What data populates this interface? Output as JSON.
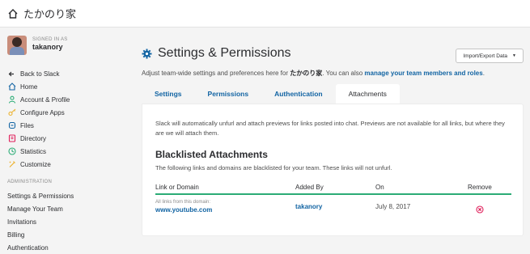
{
  "topbar": {
    "team_name": "たかのり家"
  },
  "sidebar": {
    "signed_in_label": "SIGNED IN AS",
    "username": "takanory",
    "items": [
      {
        "label": "Back to Slack",
        "icon": "arrow-left-icon"
      },
      {
        "label": "Home",
        "icon": "home-icon"
      },
      {
        "label": "Account & Profile",
        "icon": "user-icon"
      },
      {
        "label": "Configure Apps",
        "icon": "key-icon"
      },
      {
        "label": "Files",
        "icon": "files-icon"
      },
      {
        "label": "Directory",
        "icon": "directory-icon"
      },
      {
        "label": "Statistics",
        "icon": "statistics-icon"
      },
      {
        "label": "Customize",
        "icon": "customize-icon"
      }
    ],
    "admin_heading": "ADMINISTRATION",
    "admin_items": [
      "Settings & Permissions",
      "Manage Your Team",
      "Invitations",
      "Billing",
      "Authentication"
    ]
  },
  "main": {
    "title": "Settings & Permissions",
    "import_button": "Import/Export Data",
    "subtitle_prefix": "Adjust team-wide settings and preferences here for ",
    "subtitle_team": "たかのり家",
    "subtitle_mid": ". You can also ",
    "subtitle_link": "manage your team members and roles",
    "subtitle_end": ".",
    "tabs": [
      "Settings",
      "Permissions",
      "Authentication",
      "Attachments"
    ],
    "active_tab": "Attachments",
    "description": "Slack will automatically unfurl and attach previews for links posted into chat. Previews are not available for all links, but where they are we will attach them.",
    "section_title": "Blacklisted Attachments",
    "section_desc": "The following links and domains are blacklisted for your team. These links will not unfurl.",
    "table": {
      "headers": [
        "Link or Domain",
        "Added By",
        "On",
        "Remove"
      ],
      "rows": [
        {
          "hint": "All links from this domain:",
          "domain": "www.youtube.com",
          "added_by": "takanory",
          "on": "July 8, 2017"
        }
      ]
    }
  },
  "colors": {
    "link": "#1264a3",
    "accent_green": "#2bac76",
    "remove_red": "#e01e5a"
  }
}
